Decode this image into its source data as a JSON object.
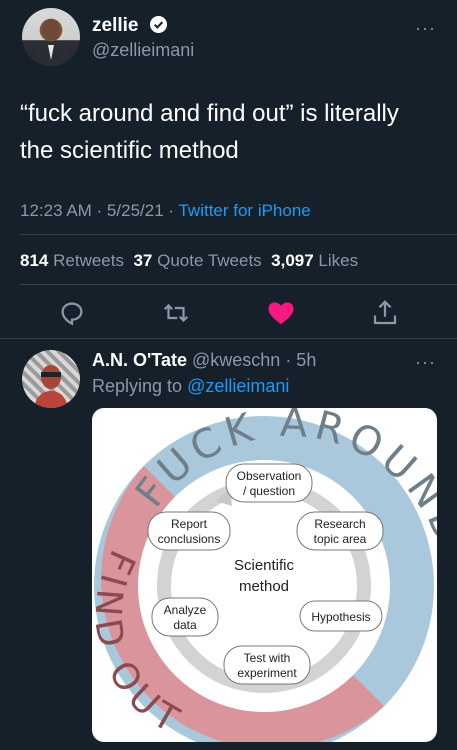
{
  "tweet": {
    "author_name": "zellie",
    "author_handle": "@zellieimani",
    "more": "···",
    "text_line1": "“fuck around and find out” is literally",
    "text_line2": "the scientific method",
    "time": "12:23 AM · 5/25/21 · ",
    "source": "Twitter for iPhone",
    "retweets_count": "814",
    "retweets_label": "Retweets",
    "quotes_count": "37",
    "quotes_label": "Quote Tweets",
    "likes_count": "3,097",
    "likes_label": "Likes",
    "actions": [
      "reply-icon",
      "retweet-icon",
      "heart-icon",
      "share-icon"
    ],
    "liked": true,
    "like_color": "#f91880",
    "link_color": "#1d9bf0"
  },
  "reply": {
    "author_name": "A.N. O'Tate",
    "author_handle": "@kweschn",
    "time": "· 5h",
    "replying_prefix": "Replying to ",
    "replying_to": "@zellieimani",
    "more": "···"
  },
  "diagram": {
    "outer_top_text": "FUCK AROUND",
    "outer_bottom_text": "FIND OUT",
    "center_line1": "Scientific",
    "center_line2": "method",
    "nodes": {
      "observation_1": "Observation",
      "observation_2": "/ question",
      "research_1": "Research",
      "research_2": "topic area",
      "hypothesis": "Hypothesis",
      "test_1": "Test with",
      "test_2": "experiment",
      "analyze_1": "Analyze",
      "analyze_2": "data",
      "report_1": "Report",
      "report_2": "conclusions"
    },
    "colors": {
      "around": "#a9c8dc",
      "find_out": "#d9959b",
      "inner_ring": "#d3d3d3"
    }
  }
}
